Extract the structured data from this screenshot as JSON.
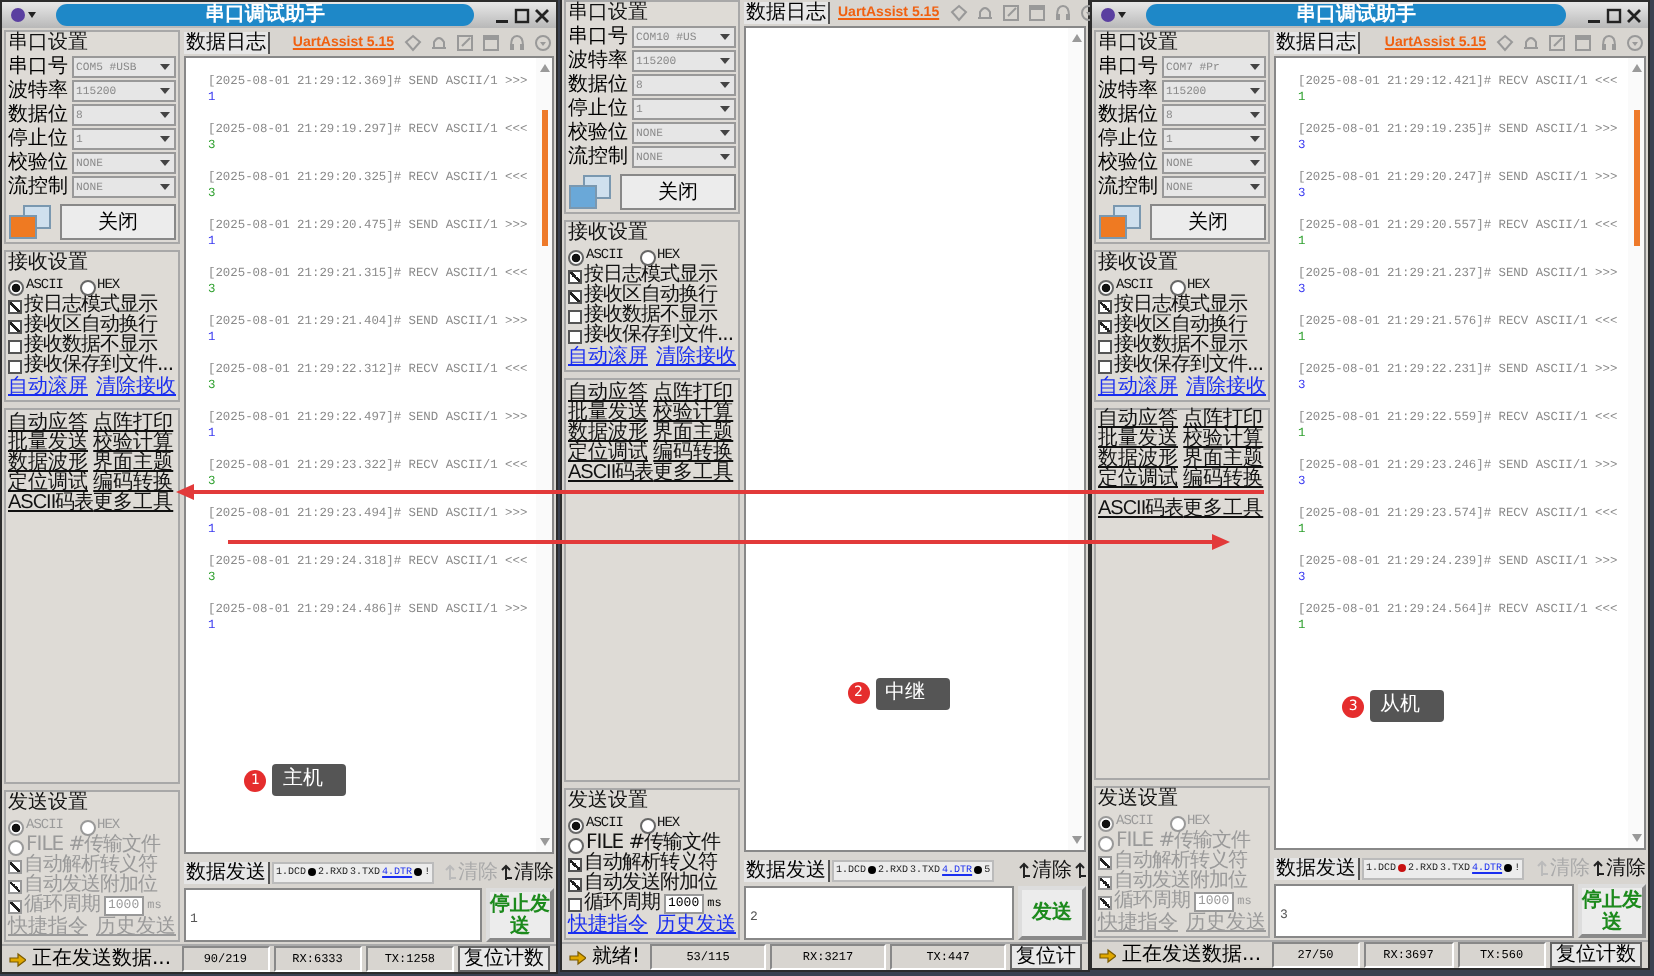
{
  "windows": [
    {
      "title": "串口调试助手",
      "port_icon_lit": true,
      "serial_settings": {
        "heading": "串口设置",
        "disabled": true,
        "fields": [
          {
            "label": "串口号",
            "value": "COM5 #USB"
          },
          {
            "label": "波特率",
            "value": "115200"
          },
          {
            "label": "数据位",
            "value": "8"
          },
          {
            "label": "停止位",
            "value": "1"
          },
          {
            "label": "校验位",
            "value": "NONE"
          },
          {
            "label": "流控制",
            "value": "NONE"
          }
        ],
        "button": "关闭"
      },
      "receive_settings": {
        "heading": "接收设置",
        "modes": [
          {
            "label": "ASCII",
            "selected": true
          },
          {
            "label": "HEX",
            "selected": false
          }
        ],
        "options": [
          {
            "label": "按日志模式显示",
            "checked": true
          },
          {
            "label": "接收区自动换行",
            "checked": true
          },
          {
            "label": "接收数据不显示",
            "checked": false
          },
          {
            "label": "接收保存到文件...",
            "checked": false
          }
        ],
        "links": [
          "自动滚屏",
          "清除接收"
        ]
      },
      "tools": [
        "自动应答",
        "点阵打印",
        "批量发送",
        "校验计算",
        "数据波形",
        "界面主题",
        "定位调试",
        "编码转换",
        "ASCII码表",
        "更多工具"
      ],
      "send_settings": {
        "heading": "发送设置",
        "disabled": true,
        "modes": [
          {
            "label": "ASCII",
            "selected": true
          },
          {
            "label": "HEX",
            "selected": false
          }
        ],
        "file_option": {
          "label": "FILE #传输文件",
          "selected": false
        },
        "options": [
          {
            "label": "自动解析转义符",
            "checked": true
          },
          {
            "label": "自动发送附加位",
            "checked": true
          },
          {
            "label": "循环周期",
            "checked": true
          }
        ],
        "period": "1000",
        "unit": "ms",
        "links": [
          "快捷指令",
          "历史发送"
        ]
      },
      "log_tab": "数据日志",
      "version_link": "UartAssist 5.15",
      "log": [
        {
          "kind": "send",
          "header": "[2025-08-01 21:29:12.369]# SEND ASCII/1 >>>",
          "data": "1"
        },
        {
          "kind": "recv",
          "header": "[2025-08-01 21:29:19.297]# RECV ASCII/1 <<<",
          "data": "3"
        },
        {
          "kind": "recv",
          "header": "[2025-08-01 21:29:20.325]# RECV ASCII/1 <<<",
          "data": "3"
        },
        {
          "kind": "send",
          "header": "[2025-08-01 21:29:20.475]# SEND ASCII/1 >>>",
          "data": "1"
        },
        {
          "kind": "recv",
          "header": "[2025-08-01 21:29:21.315]# RECV ASCII/1 <<<",
          "data": "3"
        },
        {
          "kind": "send",
          "header": "[2025-08-01 21:29:21.404]# SEND ASCII/1 >>>",
          "data": "1"
        },
        {
          "kind": "recv",
          "header": "[2025-08-01 21:29:22.312]# RECV ASCII/1 <<<",
          "data": "3"
        },
        {
          "kind": "send",
          "header": "[2025-08-01 21:29:22.497]# SEND ASCII/1 >>>",
          "data": "1"
        },
        {
          "kind": "recv",
          "header": "[2025-08-01 21:29:23.322]# RECV ASCII/1 <<<",
          "data": "3"
        },
        {
          "kind": "send",
          "header": "[2025-08-01 21:29:23.494]# SEND ASCII/1 >>>",
          "data": "1"
        },
        {
          "kind": "recv",
          "header": "[2025-08-01 21:29:24.318]# RECV ASCII/1 <<<",
          "data": "3"
        },
        {
          "kind": "send",
          "header": "[2025-08-01 21:29:24.486]# SEND ASCII/1 >>>",
          "data": "1"
        }
      ],
      "callout": {
        "number": "1",
        "label": "主机"
      },
      "send_tab": "数据发送",
      "signals": [
        {
          "label": "1.DCD",
          "kind": "lamp",
          "on": false
        },
        {
          "label": "2.RXD",
          "kind": "plain"
        },
        {
          "label": "3.TXD",
          "kind": "plain"
        },
        {
          "label": "4.DTR",
          "kind": "link-lamp",
          "on": false
        },
        {
          "label": "!",
          "kind": "plain"
        }
      ],
      "clear_buttons": [
        {
          "label": "清除",
          "disabled": true
        },
        {
          "label": "清除",
          "disabled": false
        }
      ],
      "send_input": "1",
      "send_button": "停止发送",
      "status": {
        "message": "正在发送数据...",
        "counts": "90/219",
        "rx": "RX:6333",
        "tx": "TX:1258",
        "reset": "复位计数"
      }
    },
    {
      "port_icon_lit": false,
      "serial_settings": {
        "heading": "串口设置",
        "disabled": true,
        "fields": [
          {
            "label": "串口号",
            "value": "COM10 #US"
          },
          {
            "label": "波特率",
            "value": "115200"
          },
          {
            "label": "数据位",
            "value": "8"
          },
          {
            "label": "停止位",
            "value": "1"
          },
          {
            "label": "校验位",
            "value": "NONE"
          },
          {
            "label": "流控制",
            "value": "NONE"
          }
        ],
        "button": "关闭"
      },
      "receive_settings": {
        "heading": "接收设置",
        "modes": [
          {
            "label": "ASCII",
            "selected": true
          },
          {
            "label": "HEX",
            "selected": false
          }
        ],
        "options": [
          {
            "label": "按日志模式显示",
            "checked": true
          },
          {
            "label": "接收区自动换行",
            "checked": true
          },
          {
            "label": "接收数据不显示",
            "checked": false
          },
          {
            "label": "接收保存到文件...",
            "checked": false
          }
        ],
        "links": [
          "自动滚屏",
          "清除接收"
        ]
      },
      "tools": [
        "自动应答",
        "点阵打印",
        "批量发送",
        "校验计算",
        "数据波形",
        "界面主题",
        "定位调试",
        "编码转换",
        "ASCII码表",
        "更多工具"
      ],
      "send_settings": {
        "heading": "发送设置",
        "disabled": false,
        "modes": [
          {
            "label": "ASCII",
            "selected": true
          },
          {
            "label": "HEX",
            "selected": false
          }
        ],
        "file_option": {
          "label": "FILE #传输文件",
          "selected": false
        },
        "options": [
          {
            "label": "自动解析转义符",
            "checked": true
          },
          {
            "label": "自动发送附加位",
            "checked": true
          },
          {
            "label": "循环周期",
            "checked": false
          }
        ],
        "period": "1000",
        "unit": "ms",
        "links": [
          "快捷指令",
          "历史发送"
        ]
      },
      "log_tab": "数据日志",
      "version_link": "UartAssist 5.15",
      "callout": {
        "number": "2",
        "label": "中继"
      },
      "send_tab": "数据发送",
      "signals": [
        {
          "label": "1.DCD",
          "kind": "lamp",
          "on": false
        },
        {
          "label": "2.RXD",
          "kind": "plain"
        },
        {
          "label": "3.TXD",
          "kind": "plain"
        },
        {
          "label": "4.DTR",
          "kind": "link-lamp",
          "on": false
        },
        {
          "label": "5",
          "kind": "plain"
        }
      ],
      "clear_buttons": [
        {
          "label": "清除",
          "disabled": false
        },
        {
          "disabled": false
        }
      ],
      "send_input": "2",
      "send_button": "发送",
      "status": {
        "message": "就绪!",
        "counts": "53/115",
        "rx": "RX:3217",
        "tx": "TX:447",
        "reset": "复位计"
      }
    },
    {
      "title": "串口调试助手",
      "port_icon_lit": true,
      "serial_settings": {
        "heading": "串口设置",
        "disabled": true,
        "fields": [
          {
            "label": "串口号",
            "value": "COM7 #Pr"
          },
          {
            "label": "波特率",
            "value": "115200"
          },
          {
            "label": "数据位",
            "value": "8"
          },
          {
            "label": "停止位",
            "value": "1"
          },
          {
            "label": "校验位",
            "value": "NONE"
          },
          {
            "label": "流控制",
            "value": "NONE"
          }
        ],
        "button": "关闭"
      },
      "receive_settings": {
        "heading": "接收设置",
        "modes": [
          {
            "label": "ASCII",
            "selected": true
          },
          {
            "label": "HEX",
            "selected": false
          }
        ],
        "options": [
          {
            "label": "按日志模式显示",
            "checked": true
          },
          {
            "label": "接收区自动换行",
            "checked": true
          },
          {
            "label": "接收数据不显示",
            "checked": false
          },
          {
            "label": "接收保存到文件...",
            "checked": false
          }
        ],
        "links": [
          "自动滚屏",
          "清除接收"
        ]
      },
      "tools": [
        "自动应答",
        "点阵打印",
        "批量发送",
        "校验计算",
        "数据波形",
        "界面主题",
        "定位调试",
        "编码转换",
        "ASCII码表",
        "更多工具"
      ],
      "send_settings": {
        "heading": "发送设置",
        "disabled": true,
        "modes": [
          {
            "label": "ASCII",
            "selected": true
          },
          {
            "label": "HEX",
            "selected": false
          }
        ],
        "file_option": {
          "label": "FILE #传输文件",
          "selected": false
        },
        "options": [
          {
            "label": "自动解析转义符",
            "checked": true
          },
          {
            "label": "自动发送附加位",
            "checked": true
          },
          {
            "label": "循环周期",
            "checked": true
          }
        ],
        "period": "1000",
        "unit": "ms",
        "links": [
          "快捷指令",
          "历史发送"
        ]
      },
      "log_tab": "数据日志",
      "version_link": "UartAssist 5.15",
      "log": [
        {
          "kind": "recv",
          "header": "[2025-08-01 21:29:12.421]# RECV ASCII/1 <<<",
          "data": "1"
        },
        {
          "kind": "send",
          "header": "[2025-08-01 21:29:19.235]# SEND ASCII/1 >>>",
          "data": "3"
        },
        {
          "kind": "send",
          "header": "[2025-08-01 21:29:20.247]# SEND ASCII/1 >>>",
          "data": "3"
        },
        {
          "kind": "recv",
          "header": "[2025-08-01 21:29:20.557]# RECV ASCII/1 <<<",
          "data": "1"
        },
        {
          "kind": "send",
          "header": "[2025-08-01 21:29:21.237]# SEND ASCII/1 >>>",
          "data": "3"
        },
        {
          "kind": "recv",
          "header": "[2025-08-01 21:29:21.576]# RECV ASCII/1 <<<",
          "data": "1"
        },
        {
          "kind": "send",
          "header": "[2025-08-01 21:29:22.231]# SEND ASCII/1 >>>",
          "data": "3"
        },
        {
          "kind": "recv",
          "header": "[2025-08-01 21:29:22.559]# RECV ASCII/1 <<<",
          "data": "1"
        },
        {
          "kind": "send",
          "header": "[2025-08-01 21:29:23.246]# SEND ASCII/1 >>>",
          "data": "3"
        },
        {
          "kind": "recv",
          "header": "[2025-08-01 21:29:23.574]# RECV ASCII/1 <<<",
          "data": "1"
        },
        {
          "kind": "send",
          "header": "[2025-08-01 21:29:24.239]# SEND ASCII/1 >>>",
          "data": "3"
        },
        {
          "kind": "recv",
          "header": "[2025-08-01 21:29:24.564]# RECV ASCII/1 <<<",
          "data": "1"
        }
      ],
      "callout": {
        "number": "3",
        "label": "从机"
      },
      "send_tab": "数据发送",
      "signals": [
        {
          "label": "1.DCD",
          "kind": "lamp",
          "on": true
        },
        {
          "label": "2.RXD",
          "kind": "plain"
        },
        {
          "label": "3.TXD",
          "kind": "plain"
        },
        {
          "label": "4.DTR",
          "kind": "link-lamp",
          "on": false
        },
        {
          "label": "!",
          "kind": "plain"
        }
      ],
      "clear_buttons": [
        {
          "label": "清除",
          "disabled": true
        },
        {
          "label": "清除",
          "disabled": false
        }
      ],
      "send_input": "3",
      "send_button": "停止发送",
      "status": {
        "message": "正在发送数据...",
        "counts": "27/50",
        "rx": "RX:3697",
        "tx": "TX:560",
        "reset": "复位计数"
      }
    }
  ],
  "arrows": [
    {
      "kind": "leftward"
    },
    {
      "kind": "rightward"
    }
  ]
}
